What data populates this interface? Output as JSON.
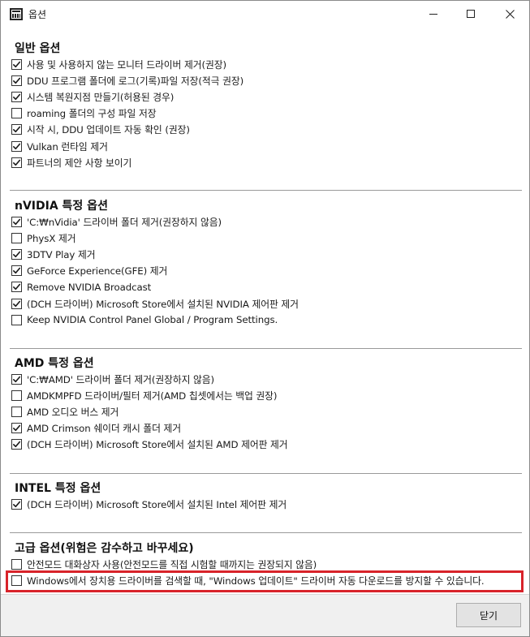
{
  "window": {
    "title": "옵션"
  },
  "sections": {
    "general": {
      "title": "일반 옵션",
      "options": [
        {
          "label": "사용 및 사용하지 않는 모니터 드라이버 제거(권장)",
          "checked": true
        },
        {
          "label": "DDU 프로그램 폴더에 로그(기록)파일 저장(적극 권장)",
          "checked": true
        },
        {
          "label": "시스템 복원지점 만들기(허용된 경우)",
          "checked": true
        },
        {
          "label": "roaming 폴더의 구성 파일 저장",
          "checked": false
        },
        {
          "label": "시작 시, DDU 업데이트 자동 확인 (권장)",
          "checked": true
        },
        {
          "label": "Vulkan 런타임 제거",
          "checked": true
        },
        {
          "label": "파트너의 제안 사항 보이기",
          "checked": true
        }
      ]
    },
    "nvidia": {
      "title": "nVIDIA 특정 옵션",
      "options": [
        {
          "label": "'C:₩nVidia' 드라이버 폴더 제거(권장하지 않음)",
          "checked": true
        },
        {
          "label": "PhysX 제거",
          "checked": false
        },
        {
          "label": "3DTV Play 제거",
          "checked": true
        },
        {
          "label": "GeForce Experience(GFE) 제거",
          "checked": true
        },
        {
          "label": "Remove NVIDIA Broadcast",
          "checked": true
        },
        {
          "label": "(DCH 드라이버) Microsoft Store에서 설치된 NVIDIA 제어판 제거",
          "checked": true
        },
        {
          "label": "Keep NVIDIA Control Panel Global / Program Settings.",
          "checked": false
        }
      ]
    },
    "amd": {
      "title": "AMD 특정 옵션",
      "options": [
        {
          "label": "'C:₩AMD' 드라이버 폴더 제거(권장하지 않음)",
          "checked": true
        },
        {
          "label": "AMDKMPFD 드라이버/필터 제거(AMD 칩셋에서는 백업 권장)",
          "checked": false
        },
        {
          "label": "AMD 오디오 버스 제거",
          "checked": false
        },
        {
          "label": "AMD Crimson 쉐이더 캐시 폴더 제거",
          "checked": true
        },
        {
          "label": "(DCH 드라이버) Microsoft Store에서 설치된 AMD 제어판 제거",
          "checked": true
        }
      ]
    },
    "intel": {
      "title": "INTEL 특정 옵션",
      "options": [
        {
          "label": "(DCH 드라이버) Microsoft Store에서 설치된 Intel 제어판 제거",
          "checked": true
        }
      ]
    },
    "advanced": {
      "title": "고급 옵션(위험은 감수하고 바꾸세요)",
      "options": [
        {
          "label": "안전모드 대화상자 사용(안전모드를 직접 시험할 때까지는 권장되지 않음)",
          "checked": false
        },
        {
          "label": "Windows에서 장치용 드라이버를 검색할 때, \"Windows 업데이트\" 드라이버 자동 다운로드를 방지할 수 있습니다.",
          "checked": false
        }
      ]
    }
  },
  "footer": {
    "close_label": "닫기"
  },
  "colors": {
    "highlight": "#d8232a",
    "check": "#1a1a1a"
  }
}
